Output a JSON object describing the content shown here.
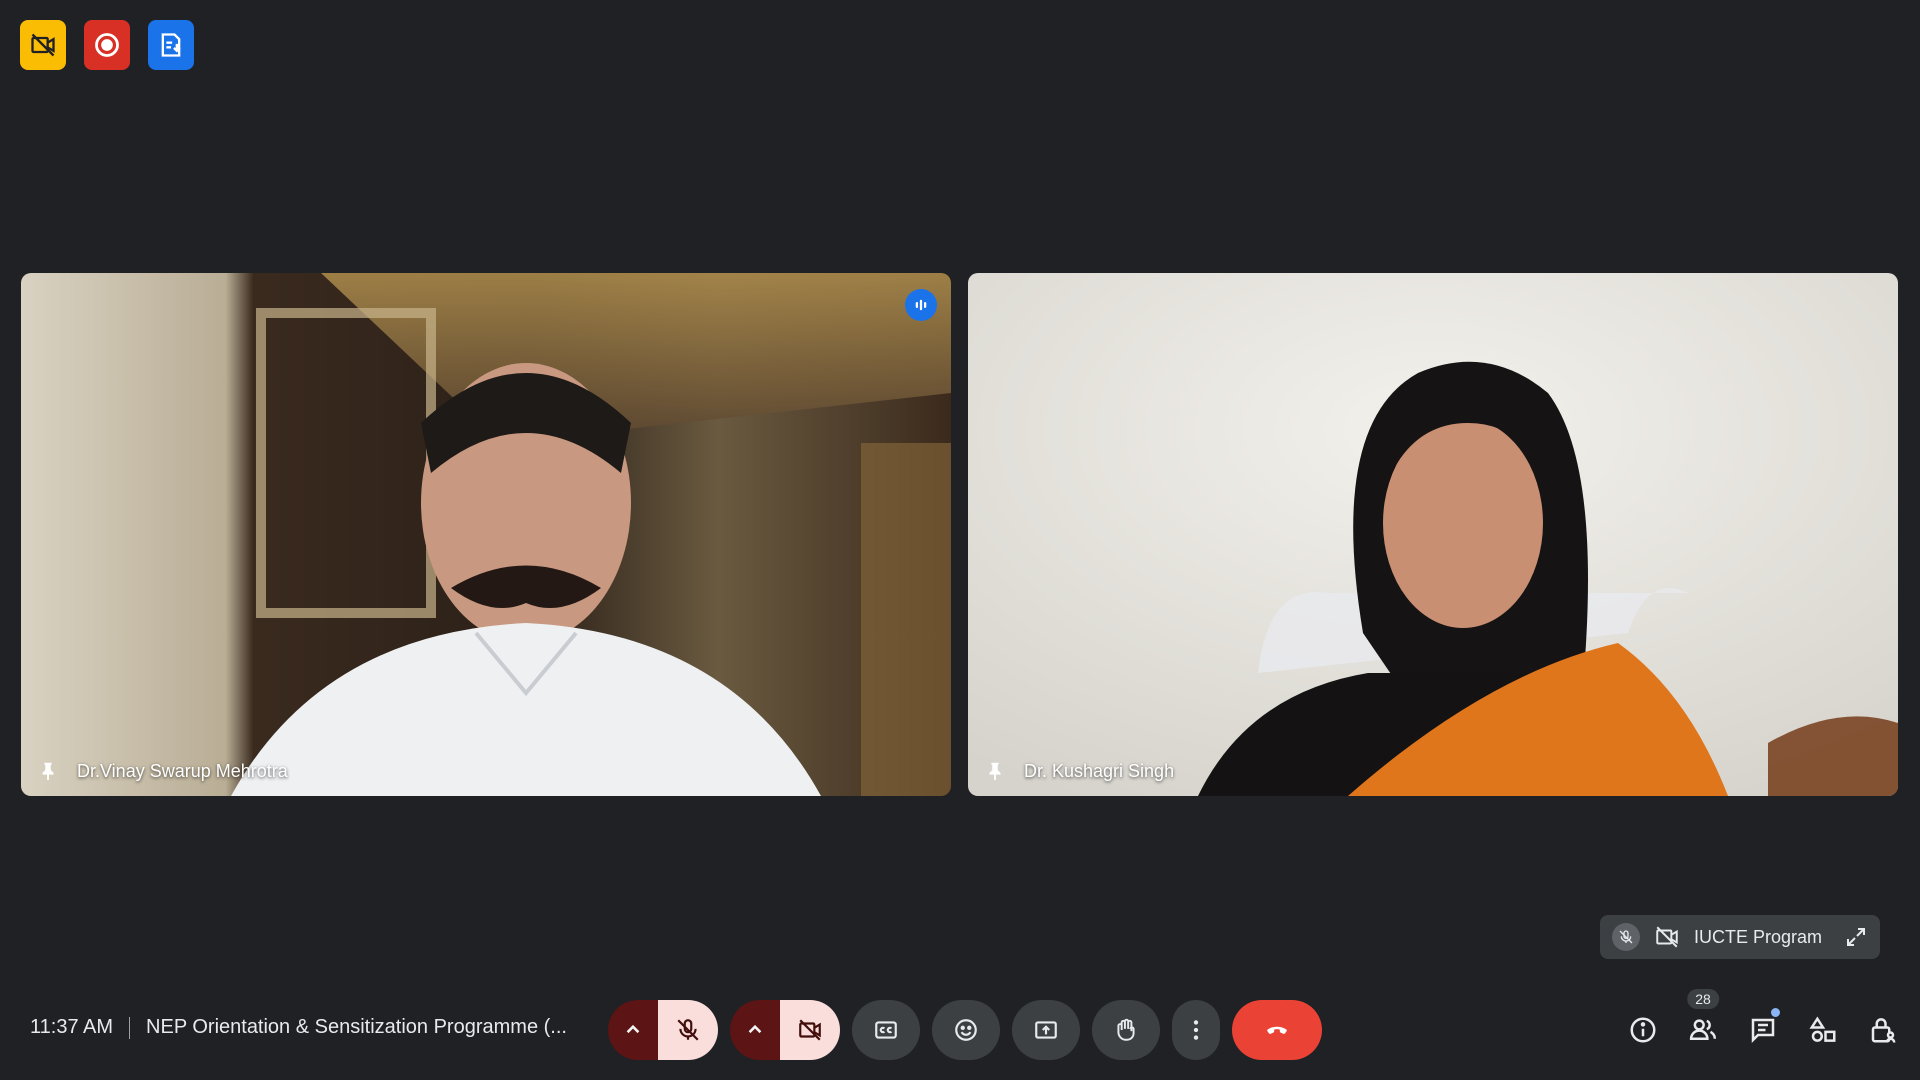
{
  "badges": [
    {
      "icon": "no-video-icon",
      "color": "#fbbc04"
    },
    {
      "icon": "recording-icon",
      "color": "#d93025"
    },
    {
      "icon": "transcript-icon",
      "color": "#1a73e8"
    }
  ],
  "participants": [
    {
      "name": "Dr.Vinay Swarup Mehrotra",
      "speaking": true
    },
    {
      "name": "Dr. Kushagri Singh",
      "speaking": false
    }
  ],
  "self_view": {
    "name": "IUCTE Program"
  },
  "meeting": {
    "time": "11:37 AM",
    "title": "NEP Orientation & Sensitization Programme (..."
  },
  "controls": {
    "mic": "muted",
    "camera": "off"
  },
  "people_count": "28",
  "colors": {
    "background": "#202124",
    "end_call": "#ea4335",
    "muted_bg": "#f9dedc",
    "muted_caret": "#5c1414"
  }
}
